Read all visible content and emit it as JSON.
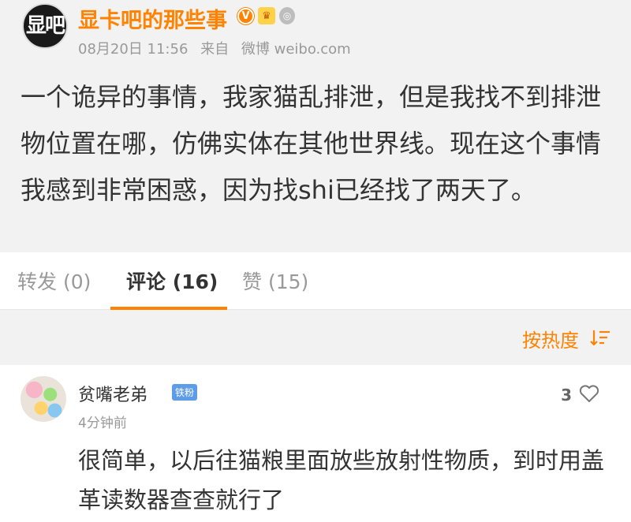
{
  "post": {
    "author": "显卡吧的那些事",
    "avatar_text": "显吧",
    "badges": [
      "verified-v-icon",
      "crown-icon",
      "medal-icon"
    ],
    "date": "08月20日 11:56",
    "source_label": "来自",
    "source": "微博 weibo.com",
    "text": "一个诡异的事情，我家猫乱排泄，但是我找不到排泄物位置在哪，仿佛实体在其他世界线。现在这个事情我感到非常困惑，因为找shi已经找了两天了。"
  },
  "tabs": [
    {
      "label": "转发 (0)",
      "active": false
    },
    {
      "label": "评论 (16)",
      "active": true
    },
    {
      "label": "赞 (15)",
      "active": false
    }
  ],
  "sort": {
    "label": "按热度"
  },
  "comment": {
    "name": "贫嘴老弟",
    "fan_badge": "铁粉",
    "time": "4分钟前",
    "likes": "3",
    "text": "很简单，以后往猫粮里面放些放射性物质，到时用盖革读数器查查就行了"
  },
  "colors": {
    "accent": "#ff8200",
    "text": "#333333",
    "muted": "#999999",
    "gray_bg": "#f2f2f2",
    "fan_badge": "#5d9de8"
  }
}
